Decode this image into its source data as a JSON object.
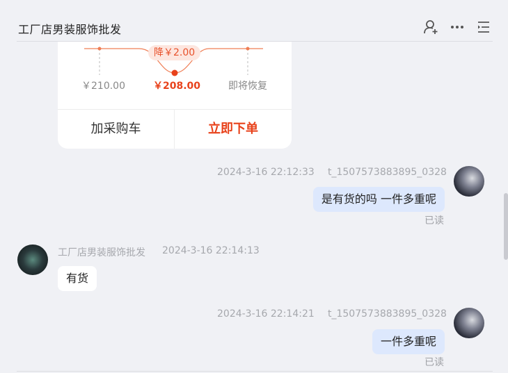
{
  "header": {
    "title": "工厂店男装服饰批发",
    "icons": [
      "add-user-icon",
      "more-icon",
      "menu-list-icon"
    ]
  },
  "order_card": {
    "discount_badge": "降￥2.00",
    "price_original": "￥210.00",
    "price_current": "￥208.00",
    "price_restore": "即将恢复",
    "add_to_cart": "加采购车",
    "buy_now": "立即下单"
  },
  "messages": [
    {
      "sender": "t_1507573883895_0328",
      "time": "2024-3-16 22:12:33",
      "text": "是有货的吗 一件多重呢",
      "status": "已读"
    },
    {
      "sender": "工厂店男装服饰批发",
      "time": "2024-3-16 22:14:13",
      "text": "有货"
    },
    {
      "sender": "t_1507573883895_0328",
      "time": "2024-3-16 22:14:21",
      "text": "一件多重呢",
      "status": "已读"
    }
  ],
  "colors": {
    "accent": "#e8421b",
    "my_bubble": "#dde8fd",
    "background": "#f0f1f5"
  }
}
